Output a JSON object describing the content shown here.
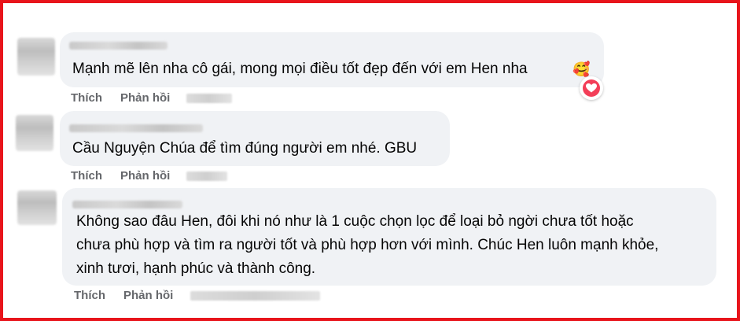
{
  "comments": [
    {
      "text": "Mạnh mẽ lên nha cô gái, mong mọi điều tốt đẹp đến với em Hen nha",
      "emoji": "🥰",
      "reaction": "love-icon",
      "like_label": "Thích",
      "reply_label": "Phản hồi"
    },
    {
      "text": "Cầu Nguyện Chúa để tìm đúng người em nhé. GBU",
      "like_label": "Thích",
      "reply_label": "Phản hồi"
    },
    {
      "text": "Không sao đâu Hen, đôi khi nó như là 1 cuộc chọn lọc để loại bỏ ngời chưa tốt hoặc\nchưa phù hợp và tìm ra người tốt và phù hợp hơn với mình. Chúc Hen luôn mạnh khỏe,\nxinh tươi, hạnh phúc và thành công.",
      "like_label": "Thích",
      "reply_label": "Phản hồi"
    }
  ],
  "colors": {
    "frame_border": "#e8141b",
    "bubble_bg": "#f0f2f5",
    "action_text": "#65676b",
    "love_reaction": "#f33e58"
  }
}
